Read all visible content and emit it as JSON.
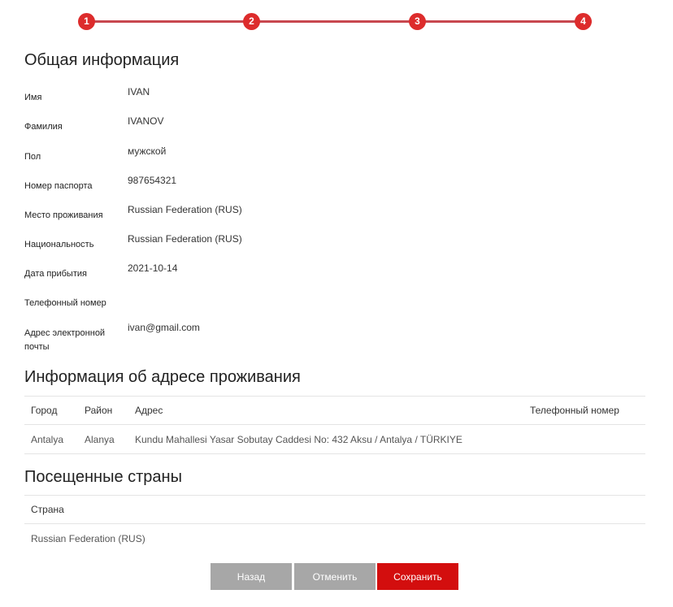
{
  "stepper": {
    "steps": [
      "1",
      "2",
      "3",
      "4"
    ]
  },
  "general": {
    "title": "Общая информация",
    "rows": [
      {
        "label": "Имя",
        "value": "IVAN"
      },
      {
        "label": "Фамилия",
        "value": "IVANOV"
      },
      {
        "label": "Пол",
        "value": "мужской"
      },
      {
        "label": "Номер паспорта",
        "value": "987654321"
      },
      {
        "label": "Место проживания",
        "value": "Russian Federation (RUS)"
      },
      {
        "label": "Национальность",
        "value": "Russian Federation (RUS)"
      },
      {
        "label": "Дата прибытия",
        "value": "2021-10-14"
      },
      {
        "label": "Телефонный номер",
        "value": ""
      },
      {
        "label": "Адрес электронной почты",
        "value": "ivan@gmail.com"
      }
    ]
  },
  "address": {
    "title": "Информация об адресе проживания",
    "columns": [
      "Город",
      "Район",
      "Адрес",
      "Телефонный номер"
    ],
    "rows": [
      {
        "city": "Antalya",
        "district": "Alanya",
        "address": "Kundu Mahallesi Yasar Sobutay Caddesi No: 432 Aksu / Antalya / TÜRKIYE",
        "phone": ""
      }
    ]
  },
  "countries": {
    "title": "Посещенные страны",
    "columns": [
      "Страна"
    ],
    "rows": [
      {
        "country": "Russian Federation (RUS)"
      }
    ]
  },
  "buttons": {
    "back": "Назад",
    "cancel": "Отменить",
    "save": "Сохранить"
  },
  "colors": {
    "accent": "#dd2c2c",
    "save_button": "#d30e0e",
    "neutral_button": "#a7a7a7"
  }
}
